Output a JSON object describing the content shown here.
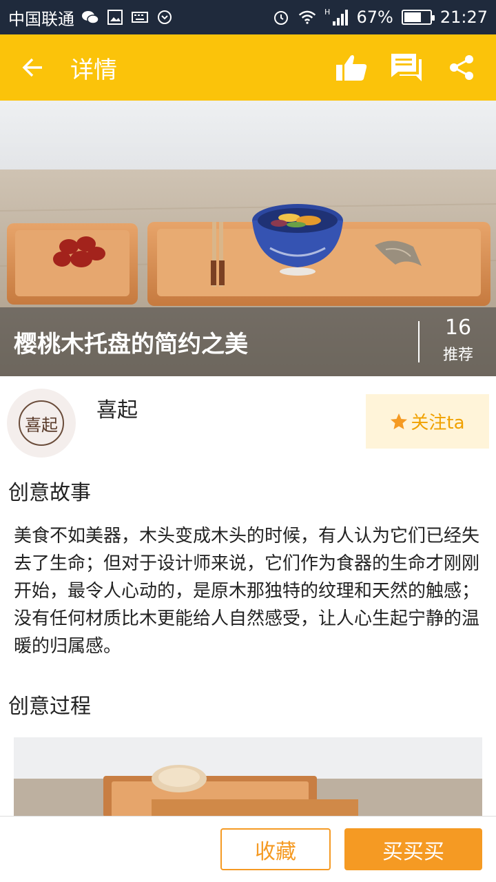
{
  "status_bar": {
    "carrier": "中国联通",
    "battery_percent": "67%",
    "battery_level": 0.67,
    "time": "21:27",
    "network": "H",
    "icons": [
      "wechat-icon",
      "image-icon",
      "keyboard-icon",
      "sync-icon",
      "alarm-icon",
      "wifi-icon",
      "signal-icon",
      "battery-icon"
    ]
  },
  "app_bar": {
    "title": "详情",
    "back_icon": "arrow-left-icon",
    "actions": [
      "thumbs-up-icon",
      "comment-icon",
      "share-icon"
    ],
    "bg_color": "#fbc30a"
  },
  "hero": {
    "title": "樱桃木托盘的简约之美",
    "recommend_count": "16",
    "recommend_label": "推荐"
  },
  "author": {
    "avatar_text": "喜起",
    "name": "喜起",
    "follow_label": "关注ta"
  },
  "story": {
    "title": "创意故事",
    "text": "美食不如美器，木头变成木头的时候，有人认为它们已经失去了生命；但对于设计师来说，它们作为食器的生命才刚刚开始，最令人心动的，是原木那独特的纹理和天然的触感；没有任何材质比木更能给人自然感受，让人心生起宁静的温暖的归属感。"
  },
  "process": {
    "title": "创意过程"
  },
  "bottom_bar": {
    "collect_label": "收藏",
    "buy_label": "买买买",
    "accent_color": "#f59a23"
  }
}
